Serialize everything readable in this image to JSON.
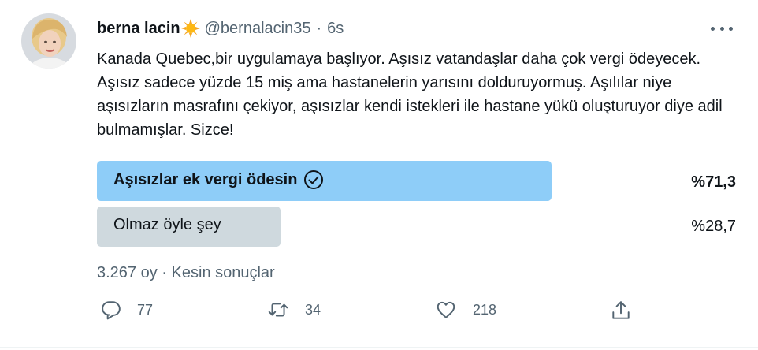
{
  "tweet": {
    "display_name": "berna lacin",
    "handle": "@bernalacin35",
    "separator": "·",
    "time": "6s",
    "text": "Kanada Quebec,bir uygulamaya başlıyor. Aşısız vatandaşlar daha çok vergi ödeyecek. Aşısız sadece yüzde 15 miş ama hastanelerin yarısını dolduruyormuş. Aşılılar niye aşısızların masrafını çekiyor, aşısızlar kendi istekleri ile hastane yükü oluşturuyor diye adil bulmamışlar. Sizce!"
  },
  "poll": {
    "options": [
      {
        "label": "Aşısızlar ek vergi ödesin",
        "percent_label": "%71,3",
        "share": 71.3,
        "winner": true,
        "color": "#8ecdf8"
      },
      {
        "label": "Olmaz öyle şey",
        "percent_label": "%28,7",
        "share": 28.7,
        "winner": false,
        "color": "#cfd9de"
      }
    ],
    "votes": "3.267 oy",
    "separator": "·",
    "status": "Kesin sonuçlar"
  },
  "actions": {
    "reply_count": "77",
    "retweet_count": "34",
    "like_count": "218"
  },
  "icons": {
    "verified_emoji": "sun-icon",
    "more": "more-icon",
    "winner_check": "check-circle-icon",
    "reply": "reply-icon",
    "retweet": "retweet-icon",
    "like": "heart-icon",
    "share": "share-icon"
  },
  "colors": {
    "text": "#0f1419",
    "secondary": "#536471",
    "winner_bar": "#8ecdf8",
    "loser_bar": "#cfd9de"
  }
}
